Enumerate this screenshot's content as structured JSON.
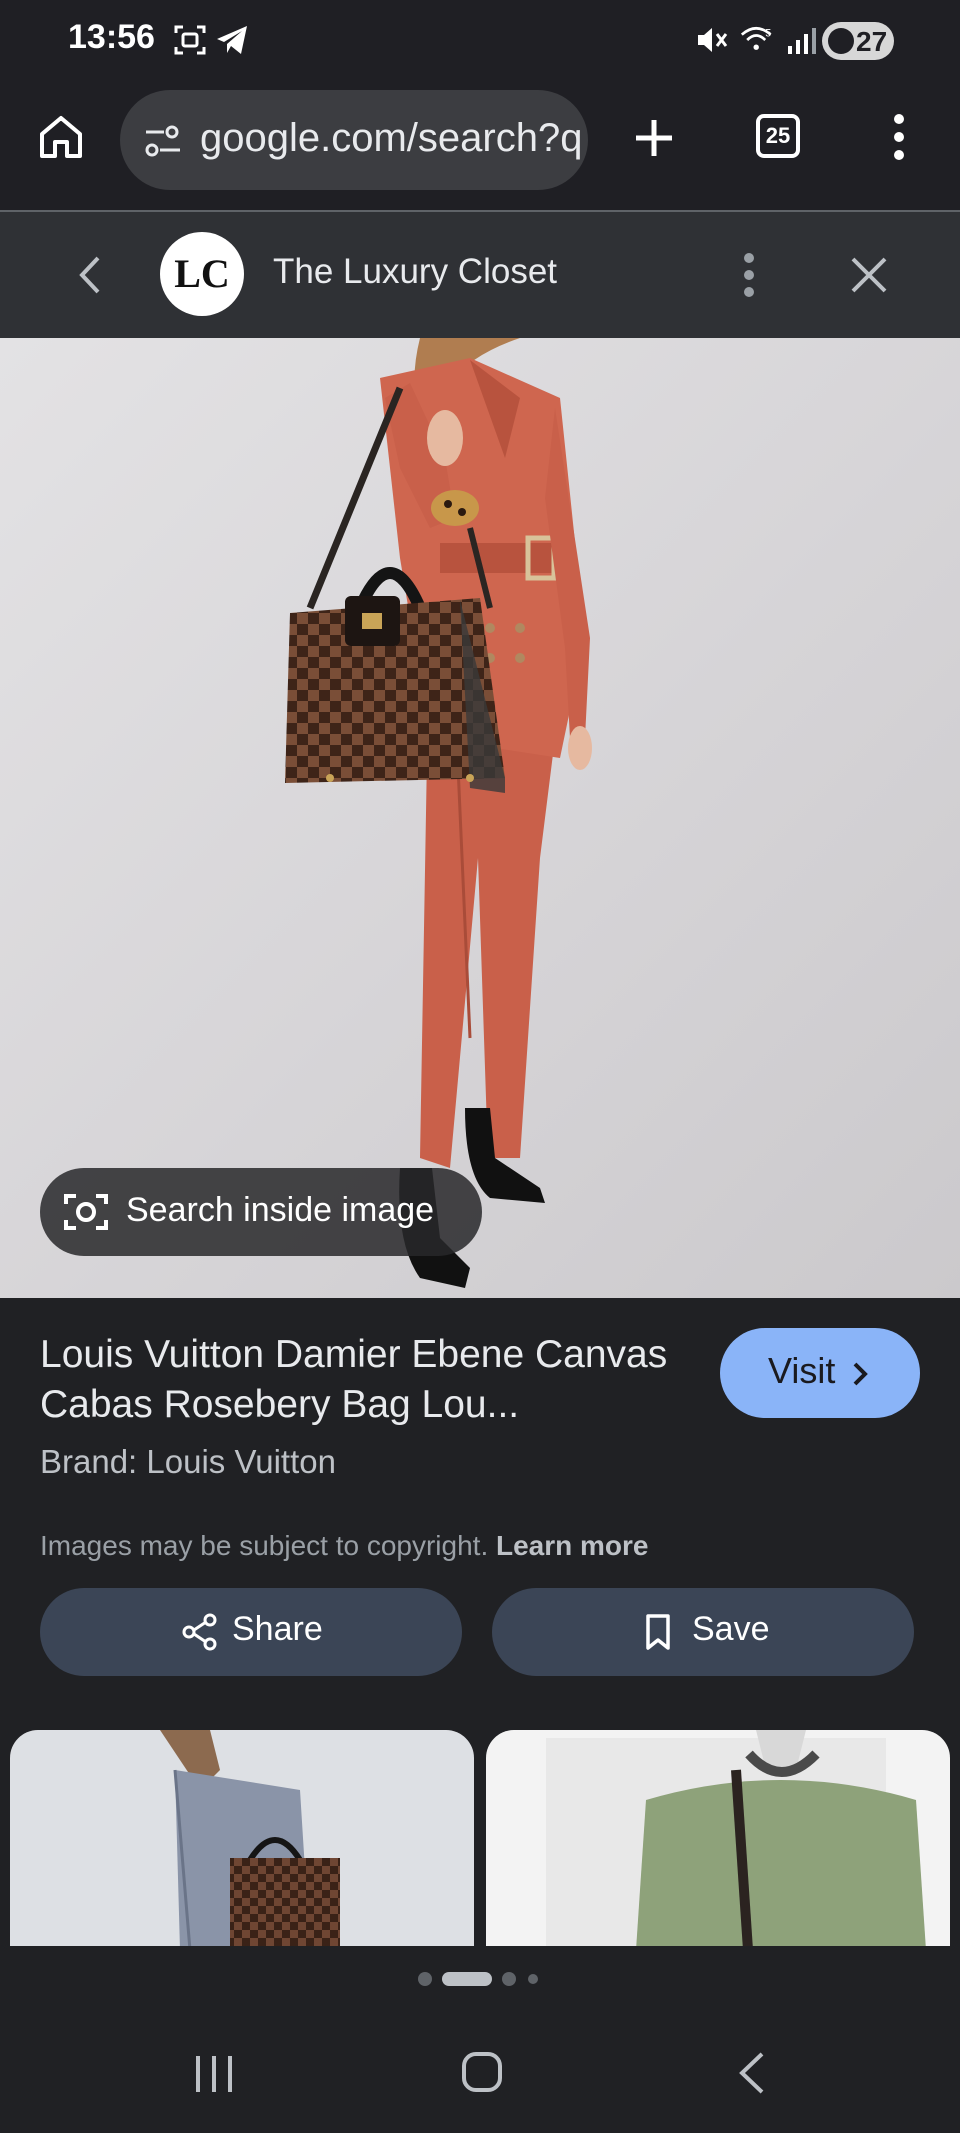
{
  "status_bar": {
    "time": "13:56",
    "battery": "27"
  },
  "browser": {
    "url": "google.com/search?q",
    "tab_count": "25"
  },
  "sheet": {
    "source_logo": "LC",
    "source_name": "The Luxury Closet"
  },
  "hero": {
    "search_inside_label": "Search inside image"
  },
  "product": {
    "title": "Louis Vuitton Damier Ebene Canvas Cabas Rosebery Bag Lou...",
    "brand": "Brand: Louis Vuitton",
    "copyright_text": "Images may be subject to copyright.",
    "learn_more": "Learn more",
    "visit_label": "Visit"
  },
  "actions": {
    "share_label": "Share",
    "save_label": "Save"
  },
  "colors": {
    "accent": "#8ab4f8",
    "pill": "#3b4556",
    "suit": "#c9604a"
  }
}
